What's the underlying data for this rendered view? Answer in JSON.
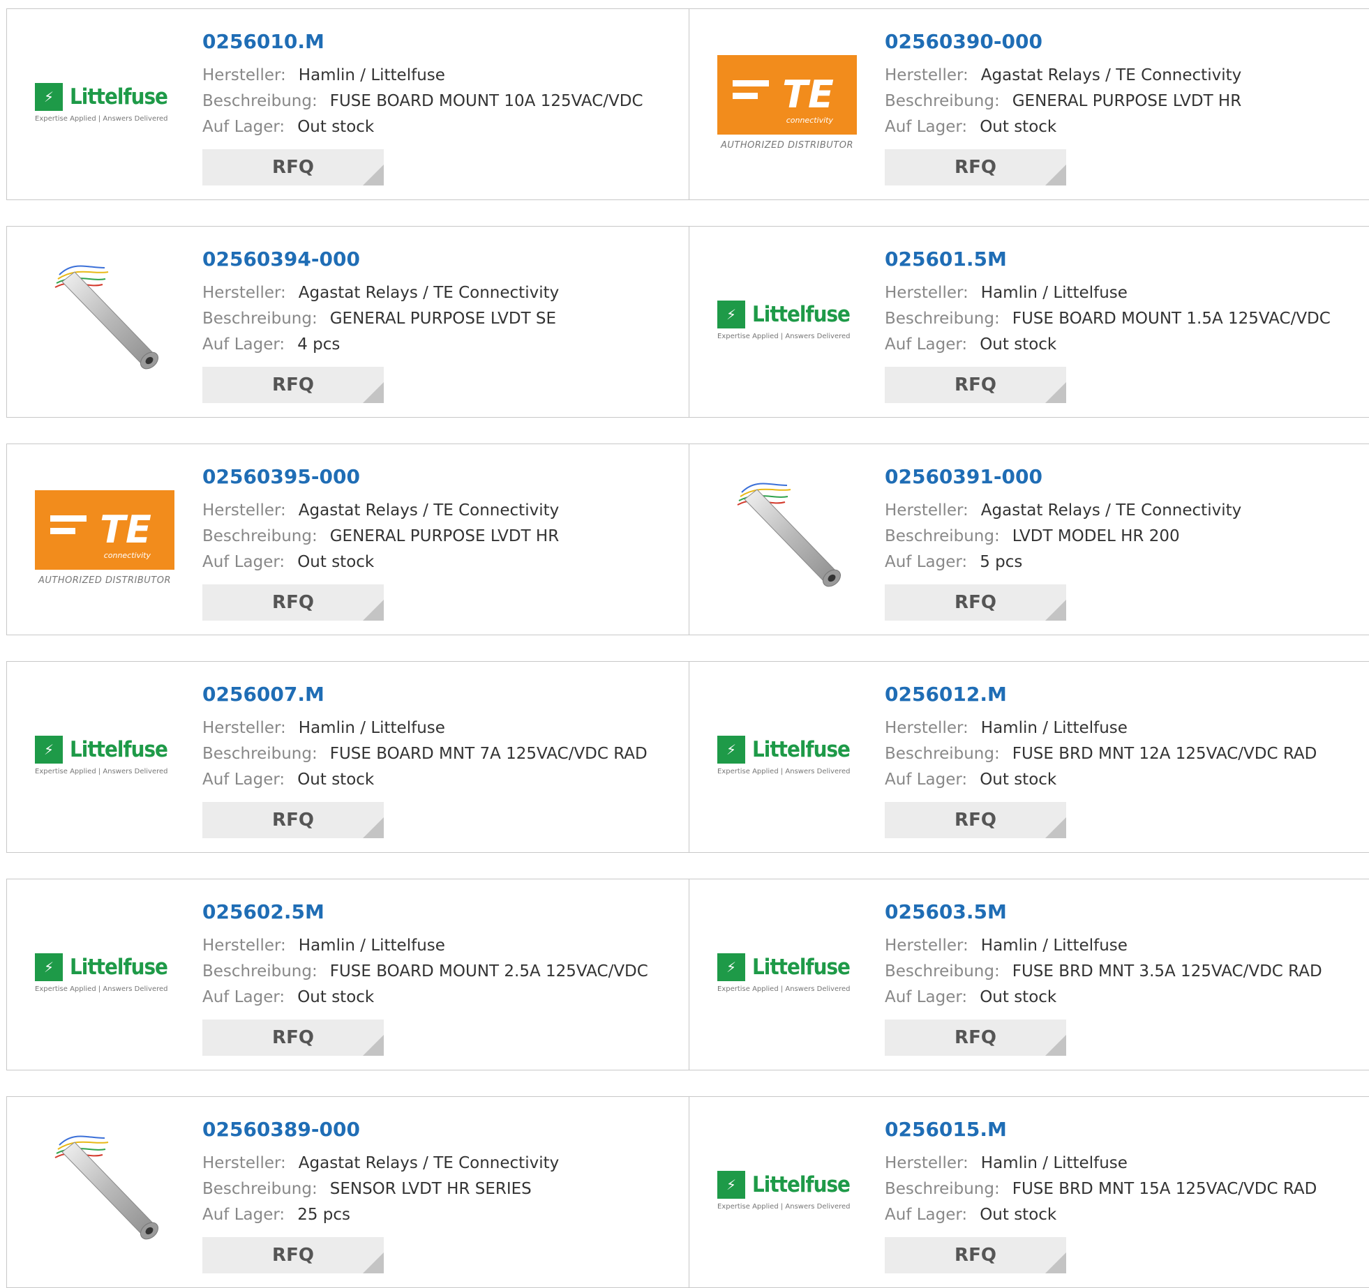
{
  "labels": {
    "manufacturer": "Hersteller:",
    "description": "Beschreibung:",
    "stock": "Auf Lager:",
    "rfq": "RFQ"
  },
  "logos": {
    "littelfuse": {
      "name": "Littelfuse",
      "tagline": "Expertise Applied | Answers Delivered",
      "color": "#1e9a48"
    },
    "te": {
      "name": "TE",
      "sub": "connectivity",
      "tag": "AUTHORIZED DISTRIBUTOR",
      "color": "#f28c1c"
    }
  },
  "products": [
    {
      "part": "0256010.M",
      "manufacturer": "Hamlin / Littelfuse",
      "description": "FUSE BOARD MOUNT 10A 125VAC/VDC",
      "stock": "Out stock",
      "image": "littelfuse-logo"
    },
    {
      "part": "02560390-000",
      "manufacturer": "Agastat Relays / TE Connectivity",
      "description": "GENERAL PURPOSE LVDT HR",
      "stock": "Out stock",
      "image": "te-logo"
    },
    {
      "part": "02560394-000",
      "manufacturer": "Agastat Relays / TE Connectivity",
      "description": "GENERAL PURPOSE LVDT SE",
      "stock": "4 pcs",
      "image": "lvdt-sensor"
    },
    {
      "part": "025601.5M",
      "manufacturer": "Hamlin / Littelfuse",
      "description": "FUSE BOARD MOUNT 1.5A 125VAC/VDC",
      "stock": "Out stock",
      "image": "littelfuse-logo"
    },
    {
      "part": "02560395-000",
      "manufacturer": "Agastat Relays / TE Connectivity",
      "description": "GENERAL PURPOSE LVDT HR",
      "stock": "Out stock",
      "image": "te-logo"
    },
    {
      "part": "02560391-000",
      "manufacturer": "Agastat Relays / TE Connectivity",
      "description": "LVDT MODEL HR 200",
      "stock": "5 pcs",
      "image": "lvdt-sensor"
    },
    {
      "part": "0256007.M",
      "manufacturer": "Hamlin / Littelfuse",
      "description": "FUSE BOARD MNT 7A 125VAC/VDC RAD",
      "stock": "Out stock",
      "image": "littelfuse-logo"
    },
    {
      "part": "0256012.M",
      "manufacturer": "Hamlin / Littelfuse",
      "description": "FUSE BRD MNT 12A 125VAC/VDC RAD",
      "stock": "Out stock",
      "image": "littelfuse-logo"
    },
    {
      "part": "025602.5M",
      "manufacturer": "Hamlin / Littelfuse",
      "description": "FUSE BOARD MOUNT 2.5A 125VAC/VDC",
      "stock": "Out stock",
      "image": "littelfuse-logo"
    },
    {
      "part": "025603.5M",
      "manufacturer": "Hamlin / Littelfuse",
      "description": "FUSE BRD MNT 3.5A 125VAC/VDC RAD",
      "stock": "Out stock",
      "image": "littelfuse-logo"
    },
    {
      "part": "02560389-000",
      "manufacturer": "Agastat Relays / TE Connectivity",
      "description": "SENSOR LVDT HR SERIES",
      "stock": "25 pcs",
      "image": "lvdt-sensor"
    },
    {
      "part": "0256015.M",
      "manufacturer": "Hamlin / Littelfuse",
      "description": "FUSE BRD MNT 15A 125VAC/VDC RAD",
      "stock": "Out stock",
      "image": "littelfuse-logo"
    }
  ],
  "colors": {
    "part_link": "#1f6db5",
    "label": "#888888",
    "value": "#333333",
    "rfq_bg": "#ececec",
    "border": "#c8c8c8"
  }
}
